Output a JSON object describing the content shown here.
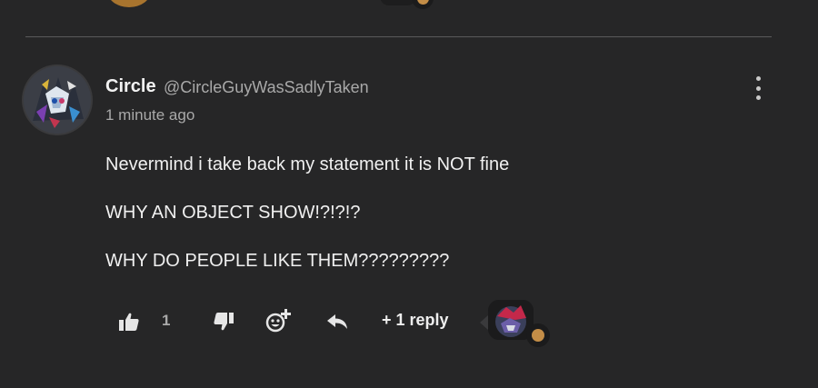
{
  "comment": {
    "display_name": "Circle",
    "handle": "@CircleGuyWasSadlyTaken",
    "timestamp": "1 minute ago",
    "body_lines": [
      "Nevermind i take back my statement it is NOT fine",
      "WHY AN OBJECT SHOW!?!?!?",
      "WHY DO PEOPLE LIKE THEM?????????"
    ],
    "like_count": "1",
    "replies_label": "+ 1 reply"
  },
  "icons": {
    "menu": "vertical-ellipsis-icon",
    "like": "thumbs-up-icon",
    "dislike": "thumbs-down-icon",
    "react": "add-reaction-icon",
    "reply": "reply-arrow-icon"
  },
  "colors": {
    "background": "#262627",
    "text_primary": "#f0f0f0",
    "text_secondary": "#a9a9a9",
    "divider": "#5a5a5b",
    "badge_accent": "#c38d47"
  }
}
